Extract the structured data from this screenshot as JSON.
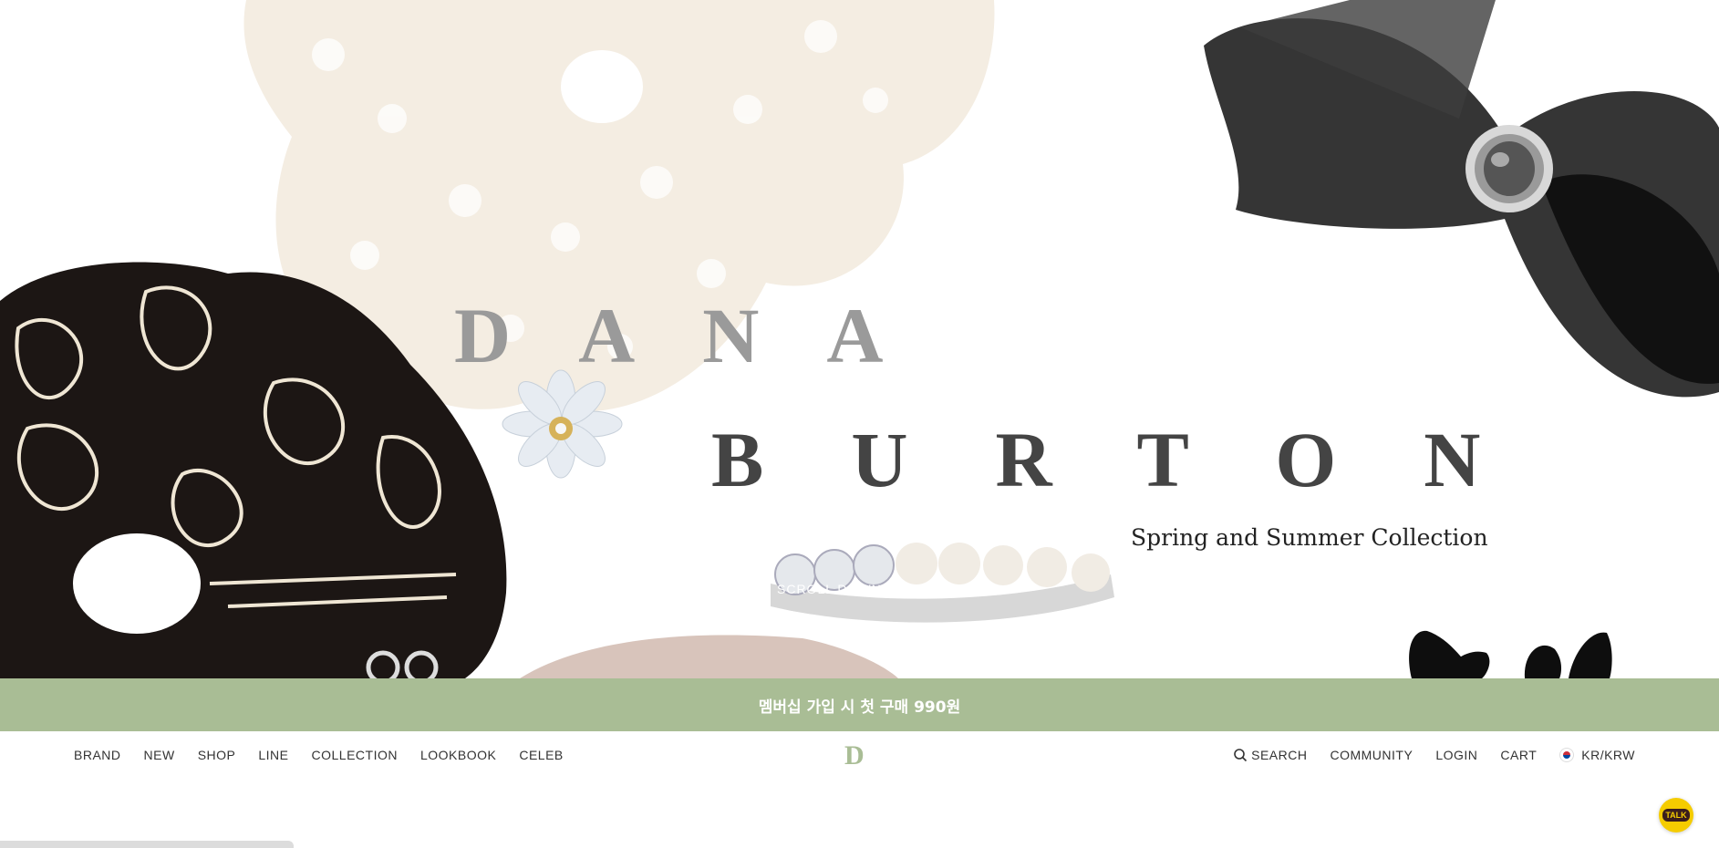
{
  "hero": {
    "title_line1": "DANA",
    "title_line2": "BURTON",
    "subtitle": "Spring and Summer Collection",
    "scroll_label": "SCROLL DOWN"
  },
  "promo": {
    "text": "멤버십 가입 시 첫 구매 990원",
    "background": "#a9bd95"
  },
  "nav": {
    "left": [
      "BRAND",
      "NEW",
      "SHOP",
      "LINE",
      "COLLECTION",
      "LOOKBOOK",
      "CELEB"
    ],
    "logo": "D",
    "search": "SEARCH",
    "community": "COMMUNITY",
    "login": "LOGIN",
    "cart": "CART",
    "locale": "KR/KRW"
  },
  "chat": {
    "label": "TALK",
    "color": "#f5cc00"
  },
  "icons": [
    "search-icon",
    "flag-kr-icon",
    "kakao-talk-icon"
  ]
}
